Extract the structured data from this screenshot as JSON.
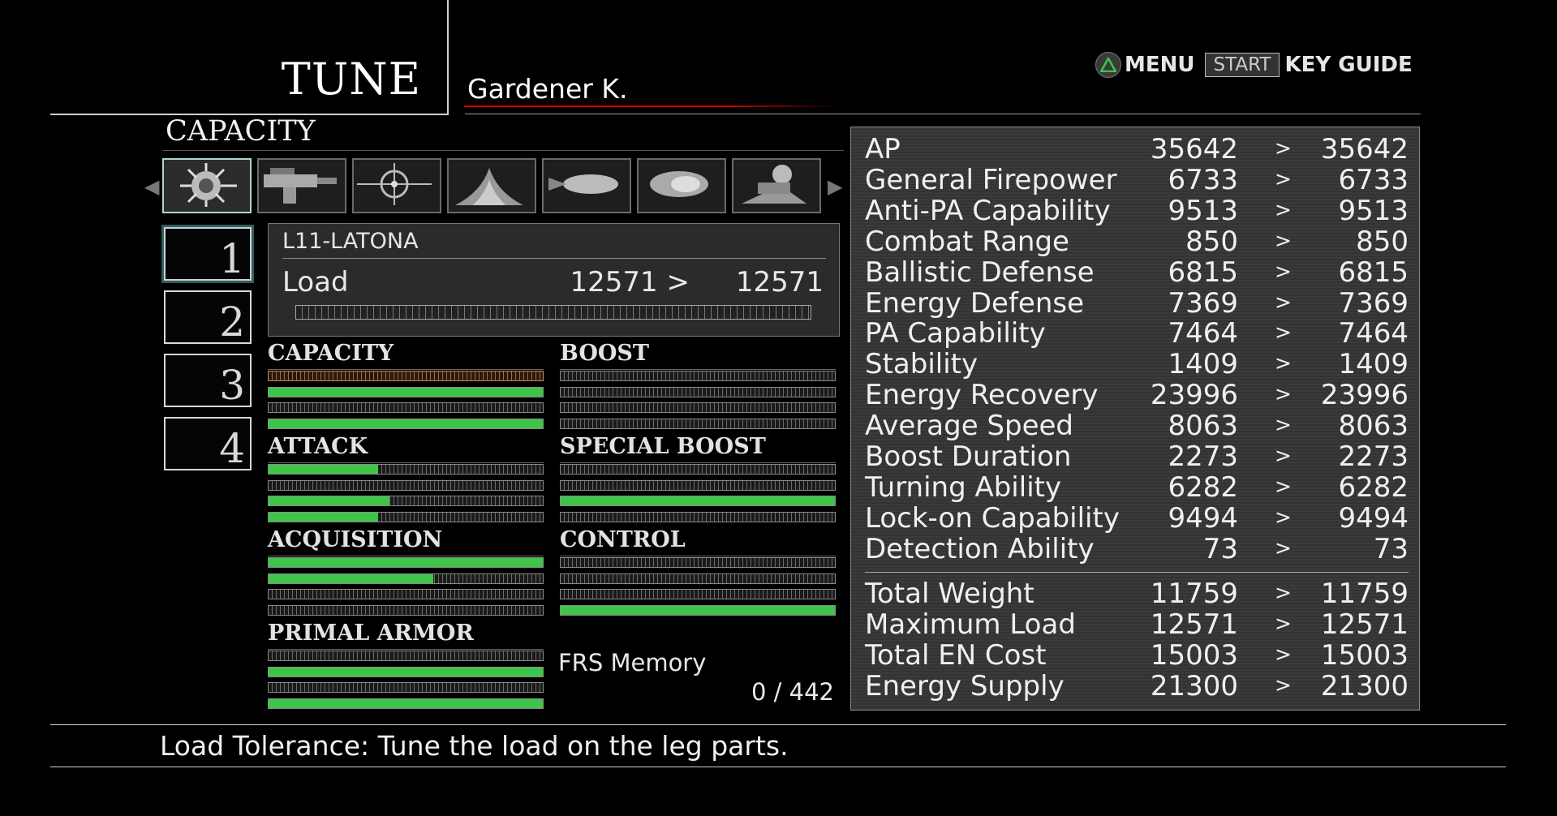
{
  "header": {
    "title": "TUNE",
    "pilot": "Gardener K."
  },
  "guide": {
    "menu_label": "MENU",
    "start_label": "START",
    "keyguide_label": "KEY GUIDE"
  },
  "section_label": "CAPACITY",
  "part_tabs": [
    {
      "icon": "head-part-icon",
      "selected": true
    },
    {
      "icon": "arm-weapon-icon",
      "selected": false
    },
    {
      "icon": "fcs-icon",
      "selected": false
    },
    {
      "icon": "generator-icon",
      "selected": false
    },
    {
      "icon": "main-booster-icon",
      "selected": false
    },
    {
      "icon": "back-booster-icon",
      "selected": false
    },
    {
      "icon": "leg-part-icon",
      "selected": false
    }
  ],
  "slots": [
    {
      "label": "1",
      "selected": true
    },
    {
      "label": "2",
      "selected": false
    },
    {
      "label": "3",
      "selected": false
    },
    {
      "label": "4",
      "selected": false
    }
  ],
  "part": {
    "name": "L11-LATONA",
    "load_label": "Load",
    "load_current": "12571 >",
    "load_new": "12571"
  },
  "tune_groups": [
    {
      "label": "CAPACITY",
      "bars": [
        0,
        1,
        0,
        1
      ],
      "highlight": 0
    },
    {
      "label": "BOOST",
      "bars": [
        0,
        0,
        0,
        0
      ]
    },
    {
      "label": "ATTACK",
      "bars": [
        0.4,
        0,
        0.44,
        0.4
      ]
    },
    {
      "label": "SPECIAL BOOST",
      "bars": [
        0,
        0,
        1,
        0
      ]
    },
    {
      "label": "ACQUISITION",
      "bars": [
        1,
        0.6,
        0,
        0
      ]
    },
    {
      "label": "CONTROL",
      "bars": [
        0,
        0,
        0,
        1
      ]
    },
    {
      "label": "PRIMAL ARMOR",
      "bars": [
        0,
        1,
        0,
        1
      ]
    }
  ],
  "frs": {
    "label": "FRS Memory",
    "value": "0 / 442"
  },
  "stats": [
    {
      "name": "AP",
      "current": "35642",
      "new": "35642"
    },
    {
      "name": "General Firepower",
      "current": "6733",
      "new": "6733"
    },
    {
      "name": "Anti-PA Capability",
      "current": "9513",
      "new": "9513"
    },
    {
      "name": "Combat Range",
      "current": "850",
      "new": "850"
    },
    {
      "name": "Ballistic Defense",
      "current": "6815",
      "new": "6815"
    },
    {
      "name": "Energy Defense",
      "current": "7369",
      "new": "7369"
    },
    {
      "name": "PA Capability",
      "current": "7464",
      "new": "7464"
    },
    {
      "name": "Stability",
      "current": "1409",
      "new": "1409"
    },
    {
      "name": "Energy Recovery",
      "current": "23996",
      "new": "23996"
    },
    {
      "name": "Average Speed",
      "current": "8063",
      "new": "8063"
    },
    {
      "name": "Boost Duration",
      "current": "2273",
      "new": "2273"
    },
    {
      "name": "Turning Ability",
      "current": "6282",
      "new": "6282"
    },
    {
      "name": "Lock-on Capability",
      "current": "9494",
      "new": "9494"
    },
    {
      "name": "Detection Ability",
      "current": "73",
      "new": "73"
    }
  ],
  "totals": [
    {
      "name": "Total Weight",
      "current": "11759",
      "new": "11759"
    },
    {
      "name": "Maximum Load",
      "current": "12571",
      "new": "12571"
    },
    {
      "name": "Total EN Cost",
      "current": "15003",
      "new": "15003"
    },
    {
      "name": "Energy Supply",
      "current": "21300",
      "new": "21300"
    }
  ],
  "arrow_glyph": ">",
  "footer": {
    "text": "Load Tolerance: Tune the load on the leg parts."
  },
  "colors": {
    "bar_fill": "#3fc44a",
    "accent_red": "#cc0000",
    "selected_border": "#a9d6d6"
  }
}
